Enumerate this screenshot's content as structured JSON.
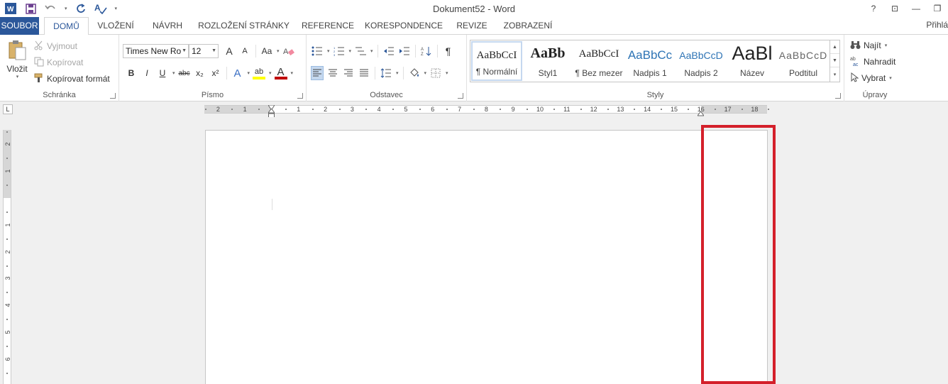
{
  "window": {
    "title": "Dokument52 - Word",
    "help": "?",
    "ribbon_display": "⊡",
    "minimize": "—",
    "restore": "❐"
  },
  "qat": {
    "undo_dd": "▾",
    "more": "▾"
  },
  "tabs": [
    {
      "label": "SOUBOR"
    },
    {
      "label": "DOMŮ"
    },
    {
      "label": "VLOŽENÍ"
    },
    {
      "label": "NÁVRH"
    },
    {
      "label": "ROZLOŽENÍ STRÁNKY"
    },
    {
      "label": "REFERENCE"
    },
    {
      "label": "KORESPONDENCE"
    },
    {
      "label": "REVIZE"
    },
    {
      "label": "ZOBRAZENÍ"
    }
  ],
  "signin": "Přihlá",
  "clipboard": {
    "label": "Schránka",
    "paste": "Vložit",
    "cut": "Vyjmout",
    "copy": "Kopírovat",
    "format_painter": "Kopírovat formát"
  },
  "font": {
    "label": "Písmo",
    "name": "Times New Ro",
    "size": "12",
    "grow": "A",
    "shrink": "A",
    "case": "Aa",
    "bold": "B",
    "italic": "I",
    "underline": "U",
    "strike": "abc",
    "sub": "x₂",
    "sup": "x²",
    "effects": "A",
    "highlight": "ab",
    "color": "A"
  },
  "paragraph": {
    "label": "Odstavec"
  },
  "styles": {
    "label": "Styly",
    "items": [
      {
        "sample": "AaBbCcI",
        "name": "¶ Normální"
      },
      {
        "sample": "AaBb",
        "name": "Styl1"
      },
      {
        "sample": "AaBbCcI",
        "name": "¶ Bez mezer"
      },
      {
        "sample": "AaBbCc",
        "name": "Nadpis 1"
      },
      {
        "sample": "AaBbCcD",
        "name": "Nadpis 2"
      },
      {
        "sample": "AaBl",
        "name": "Název"
      },
      {
        "sample": "AaBbCcD",
        "name": "Podtitul"
      }
    ]
  },
  "editing": {
    "label": "Úpravy",
    "find": "Najít",
    "replace": "Nahradit",
    "select": "Vybrat"
  },
  "ruler": {
    "h_labels": [
      "2",
      "1",
      "1",
      "2",
      "3",
      "4",
      "5",
      "6",
      "7",
      "8",
      "9",
      "10",
      "11",
      "12",
      "13",
      "14",
      "15",
      "16",
      "17",
      "18"
    ],
    "v_labels": [
      "2",
      "1",
      "1",
      "2",
      "3",
      "4",
      "5",
      "6"
    ],
    "tab_selector": "L"
  },
  "colors": {
    "accent": "#2b579a",
    "highlight_box": "#d4202b",
    "highlighter": "#ffff00",
    "font_color": "#c00000"
  }
}
